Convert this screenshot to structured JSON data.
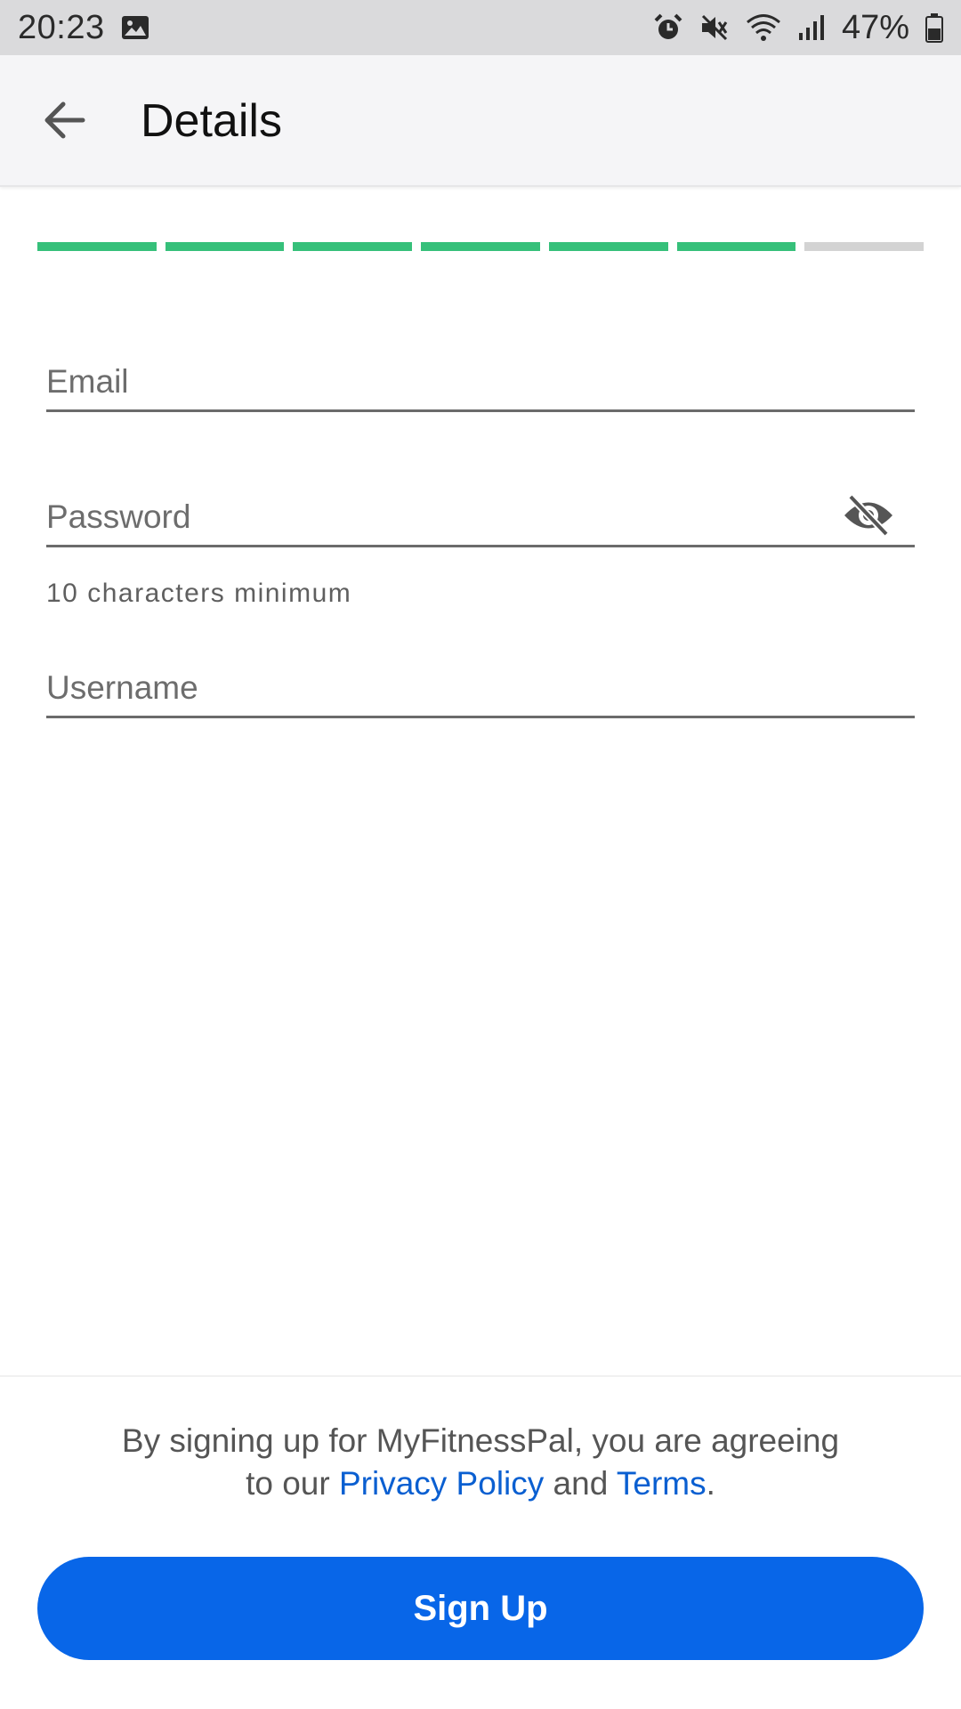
{
  "status_bar": {
    "time": "20:23",
    "battery_percent": "47%",
    "icons": [
      "image-icon",
      "alarm-icon",
      "mute-icon",
      "wifi-icon",
      "signal-icon",
      "battery-icon"
    ]
  },
  "header": {
    "title": "Details",
    "back_icon": "arrow-left-icon"
  },
  "progress": {
    "total_steps": 7,
    "completed_steps": 6,
    "done_color": "#36c07a",
    "todo_color": "#d3d3d3"
  },
  "form": {
    "email": {
      "placeholder": "Email",
      "value": ""
    },
    "password": {
      "placeholder": "Password",
      "value": "",
      "helper": "10 characters minimum",
      "visibility_icon": "eye-off-icon"
    },
    "username": {
      "placeholder": "Username",
      "value": ""
    }
  },
  "footer": {
    "terms_line1": "By signing up for MyFitnessPal, you are agreeing",
    "terms_to_our": "to our ",
    "privacy_link": "Privacy Policy",
    "terms_and": " and ",
    "terms_link": "Terms",
    "terms_end": ".",
    "signup_label": "Sign Up",
    "accent_color": "#0866e8",
    "link_color": "#0a5fd1"
  }
}
